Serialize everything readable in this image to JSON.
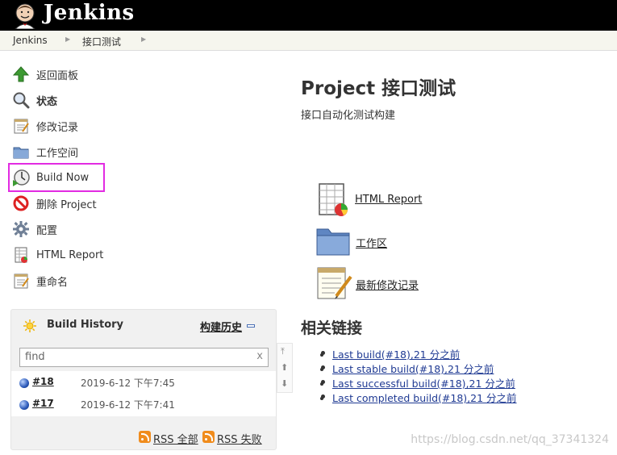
{
  "header": {
    "brand": "Jenkins"
  },
  "breadcrumb": [
    "Jenkins",
    "接口测试"
  ],
  "tasks": [
    {
      "label": "返回面板",
      "icon": "up-arrow-icon"
    },
    {
      "label": "状态",
      "icon": "magnifier-icon"
    },
    {
      "label": "修改记录",
      "icon": "notepad-icon"
    },
    {
      "label": "工作空间",
      "icon": "folder-icon"
    },
    {
      "label": "Build Now",
      "icon": "clock-build-icon"
    },
    {
      "label": "删除 Project",
      "icon": "no-entry-icon"
    },
    {
      "label": "配置",
      "icon": "gear-icon"
    },
    {
      "label": "HTML Report",
      "icon": "report-icon"
    },
    {
      "label": "重命名",
      "icon": "notepad-icon"
    }
  ],
  "build_history": {
    "title": "Build History",
    "trend_label": "构建历史",
    "search_placeholder": "find",
    "clear_label": "x",
    "builds": [
      {
        "number": "#18",
        "date": "2019-6-12 下午7:45"
      },
      {
        "number": "#17",
        "date": "2019-6-12 下午7:41"
      }
    ],
    "rss_all": "RSS 全部",
    "rss_fail": "RSS 失败"
  },
  "main": {
    "title": "Project 接口测试",
    "description": "接口自动化测试构建",
    "links": [
      {
        "label": "HTML Report",
        "icon": "report-icon"
      },
      {
        "label": "工作区",
        "icon": "folder-icon"
      },
      {
        "label": "最新修改记录",
        "icon": "notepad-icon"
      }
    ],
    "related_title": "相关链接",
    "related_links": [
      "Last build(#18),21 分之前",
      "Last stable build(#18),21 分之前",
      "Last successful build(#18),21 分之前",
      "Last completed build(#18),21 分之前"
    ]
  },
  "watermark": "https://blog.csdn.net/qq_37341324",
  "colors": {
    "header_bg": "#000000",
    "highlight": "#e22be2",
    "link": "#1f3a93"
  }
}
